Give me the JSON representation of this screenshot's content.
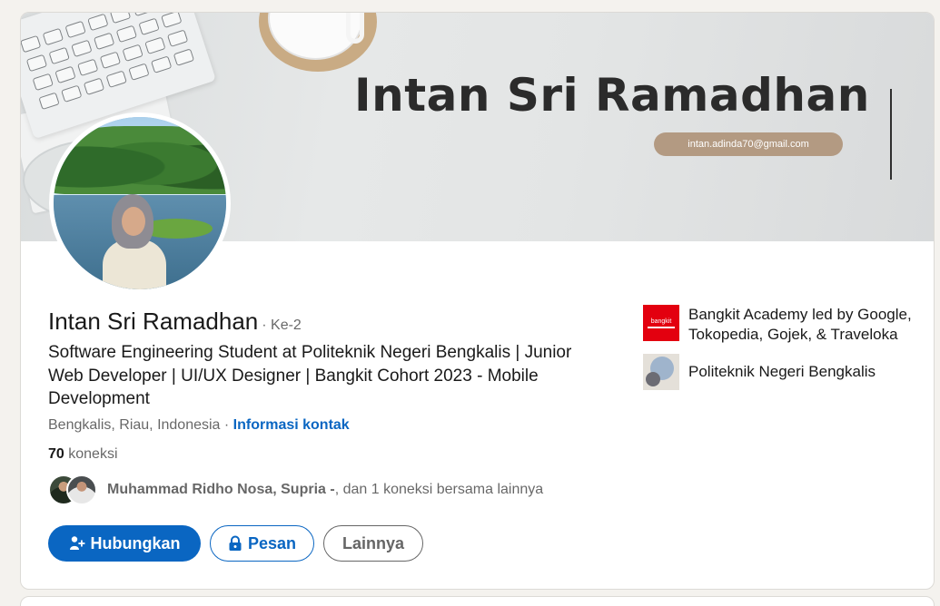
{
  "profile": {
    "name": "Intan Sri Ramadhan",
    "degree": "· Ke-2",
    "headline": "Software Engineering Student at Politeknik Negeri Bengkalis | Junior Web Developer | UI/UX Designer | Bangkit Cohort 2023 - Mobile Development",
    "location": "Bengkalis, Riau, Indonesia",
    "location_separator": " · ",
    "contact_link": "Informasi kontak",
    "connections_count": "70",
    "connections_label": " koneksi",
    "mutual": {
      "names": "Muhammad Ridho Nosa, Supria -",
      "suffix": ", dan 1 koneksi bersama lainnya"
    }
  },
  "banner": {
    "title": "Intan Sri Ramadhan",
    "email": "intan.adinda70@gmail.com"
  },
  "actions": {
    "connect": "Hubungkan",
    "message": "Pesan",
    "more": "Lainnya"
  },
  "organizations": [
    {
      "name": "Bangkit Academy led by Google, Tokopedia, Gojek, & Traveloka",
      "logo_text": "bangkit",
      "icon": "bangkit-logo"
    },
    {
      "name": "Politeknik Negeri Bengkalis",
      "icon": "polbeng-logo"
    }
  ],
  "colors": {
    "primary": "#0a66c2",
    "banner_email_bg": "#b39a82",
    "bangkit_red": "#e3000f"
  }
}
